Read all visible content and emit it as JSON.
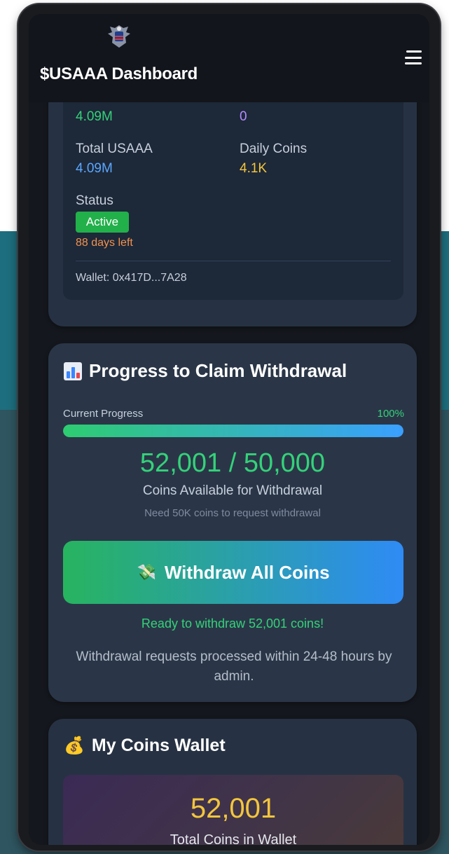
{
  "header": {
    "title": "$USAAA Dashboard",
    "logo_icon": "eagle-emblem-icon",
    "menu_icon": "hamburger-menu-icon"
  },
  "stats": {
    "top_left_value": "4.09M",
    "top_right_value": "0",
    "total_usaaa_label": "Total USAAA",
    "total_usaaa_value": "4.09M",
    "daily_coins_label": "Daily Coins",
    "daily_coins_value": "4.1K",
    "status_label": "Status",
    "status_badge": "Active",
    "days_left": "88 days left",
    "wallet": "Wallet: 0x417D...7A28"
  },
  "progress": {
    "title": "Progress to Claim Withdrawal",
    "title_icon": "bar-chart-icon",
    "current_label": "Current Progress",
    "percent_text": "100%",
    "percent_value": 1.0,
    "coin_count": "52,001 / 50,000",
    "coins_available": "Coins Available for Withdrawal",
    "need_note": "Need 50K coins to request withdrawal",
    "withdraw_button": "Withdraw All Coins",
    "withdraw_icon": "money-with-wings-icon",
    "ready_text": "Ready to withdraw 52,001 coins!",
    "processed_text": "Withdrawal requests processed within 24-48 hours by admin."
  },
  "wallet_card": {
    "title": "My Coins Wallet",
    "title_icon": "money-bag-icon",
    "total": "52,001",
    "total_label": "Total Coins in Wallet"
  },
  "colors": {
    "accent_green": "#34d27a",
    "accent_blue": "#5aa7ff",
    "accent_yellow": "#f3c63c",
    "accent_purple": "#b48cff",
    "days_orange": "#f1924f"
  }
}
